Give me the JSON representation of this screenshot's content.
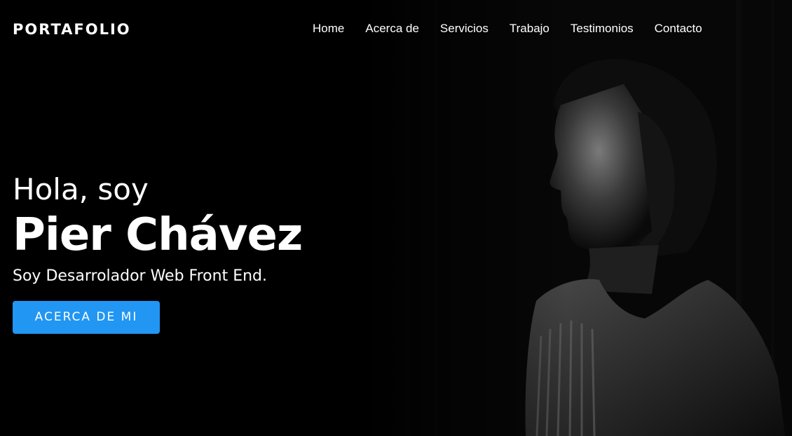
{
  "nav": {
    "logo": "PORTAFOLIO",
    "items": [
      {
        "label": "Home"
      },
      {
        "label": "Acerca de"
      },
      {
        "label": "Servicios"
      },
      {
        "label": "Trabajo"
      },
      {
        "label": "Testimonios"
      },
      {
        "label": "Contacto"
      }
    ]
  },
  "hero": {
    "greeting": "Hola, soy",
    "name": "Pier Chávez",
    "role": "Soy Desarrolador Web Front End.",
    "cta_label": "ACERCA DE MI",
    "image_subject": "portrait-silhouette"
  },
  "colors": {
    "background": "#000000",
    "accent": "#2196f3",
    "text": "#ffffff"
  }
}
